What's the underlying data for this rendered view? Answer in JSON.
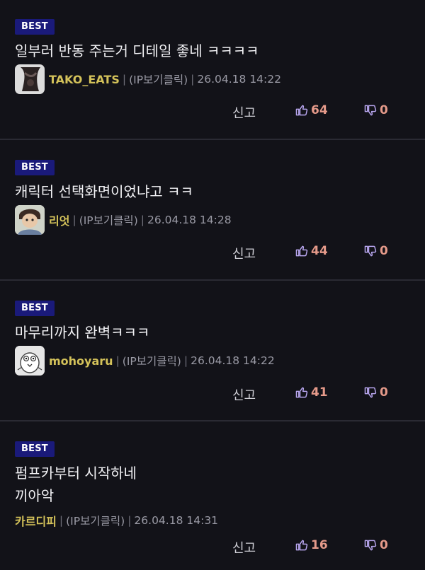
{
  "comments": [
    {
      "badge": "BEST",
      "lines": [
        "일부러 반동 주는거 디테일 좋네 ㅋㅋㅋㅋ"
      ],
      "author": "TAKO_EATS",
      "ip_label": "(IP보기클릭)",
      "date": "26.04.18 14:22",
      "report_label": "신고",
      "likes": "64",
      "dislikes": "0",
      "avatar_icon": "dark-figure-avatar"
    },
    {
      "badge": "BEST",
      "lines": [
        "캐릭터 선택화면이었냐고 ㅋㅋ"
      ],
      "author": "리엇",
      "ip_label": "(IP보기클릭)",
      "date": "26.04.18 14:28",
      "report_label": "신고",
      "likes": "44",
      "dislikes": "0",
      "avatar_icon": "cartoon-character-avatar"
    },
    {
      "badge": "BEST",
      "lines": [
        "마무리까지 완벽ㅋㅋㅋ"
      ],
      "author": "mohoyaru",
      "ip_label": "(IP보기클릭)",
      "date": "26.04.18 14:22",
      "report_label": "신고",
      "likes": "41",
      "dislikes": "0",
      "avatar_icon": "sketch-bird-avatar"
    },
    {
      "badge": "BEST",
      "lines": [
        "펌프카부터 시작하네",
        "끼아악"
      ],
      "author": "카르디피",
      "ip_label": "(IP보기클릭)",
      "date": "26.04.18 14:31",
      "report_label": "신고",
      "likes": "16",
      "dislikes": "0",
      "avatar_icon": ""
    }
  ],
  "colors": {
    "background": "#121218",
    "badge": "#1a1a7a",
    "author": "#d4c25a",
    "count": "#e59a8a",
    "divider": "#2a2a33"
  }
}
